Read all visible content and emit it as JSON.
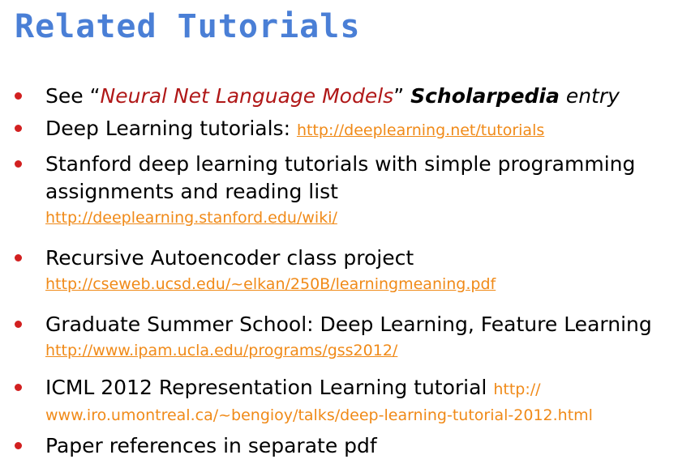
{
  "title": "Related Tutorials",
  "colors": {
    "title": "#4a7fd6",
    "bullet": "#d22020",
    "link": "#f08a18",
    "emphasis": "#b01818"
  },
  "items": [
    {
      "prefix": "See “",
      "emph": "Neural Net Language Models",
      "mid": "” ",
      "strong": "Scholarpedia",
      "suffix": " entry"
    },
    {
      "text": "Deep Learning tutorials: ",
      "link": "http://deeplearning.net/tutorials"
    },
    {
      "text": "Stanford deep learning tutorials with simple programming assignments and reading list",
      "link": "http://deeplearning.stanford.edu/wiki/"
    },
    {
      "text": "Recursive Autoencoder class project",
      "link": "http://cseweb.ucsd.edu/~elkan/250B/learningmeaning.pdf"
    },
    {
      "text": "Graduate Summer School: Deep Learning, Feature Learning",
      "link": "http://www.ipam.ucla.edu/programs/gss2012/"
    },
    {
      "text": "ICML 2012 Representation Learning tutorial ",
      "link_part1": "http://",
      "link_part2": "www.iro.umontreal.ca/~bengioy/talks/deep-learning-tutorial-2012.html"
    },
    {
      "text": "Paper references in separate pdf"
    }
  ]
}
